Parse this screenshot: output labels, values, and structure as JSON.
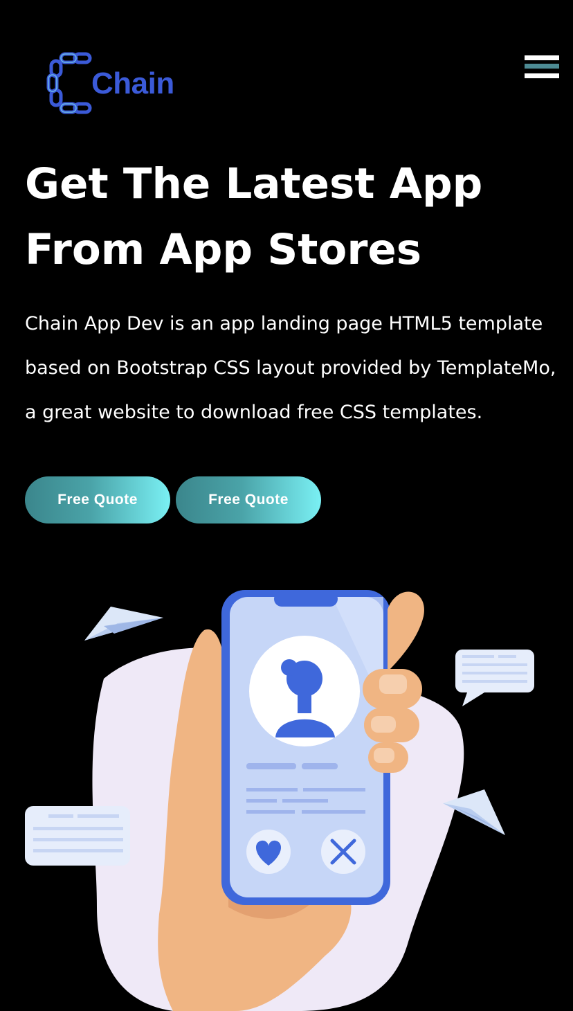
{
  "header": {
    "logo_text": "Chain",
    "logo_icon": "chain-link-icon",
    "menu_icon": "hamburger-menu-icon"
  },
  "hero": {
    "title_line1": "Get The Latest App",
    "title_line2": "From App Stores",
    "description_line1": "Chain App Dev is an app landing page HTML5 template",
    "description_line2": "based on Bootstrap CSS layout provided by TemplateMo,",
    "description_line3": "a great website to download free CSS templates.",
    "buttons": [
      "Free Quote",
      "Free Quote"
    ]
  },
  "illustration": {
    "name": "hand-holding-phone-profile-illustration",
    "icons": [
      "paper-plane-icon",
      "chat-bubble-icon",
      "avatar-icon",
      "heart-icon",
      "close-icon"
    ]
  },
  "colors": {
    "background": "#000000",
    "logo_blue": "#3b5ad8",
    "button_gradient_start": "#3b868c",
    "button_gradient_end": "#7af0f4",
    "menu_accent": "#4d8b94"
  }
}
